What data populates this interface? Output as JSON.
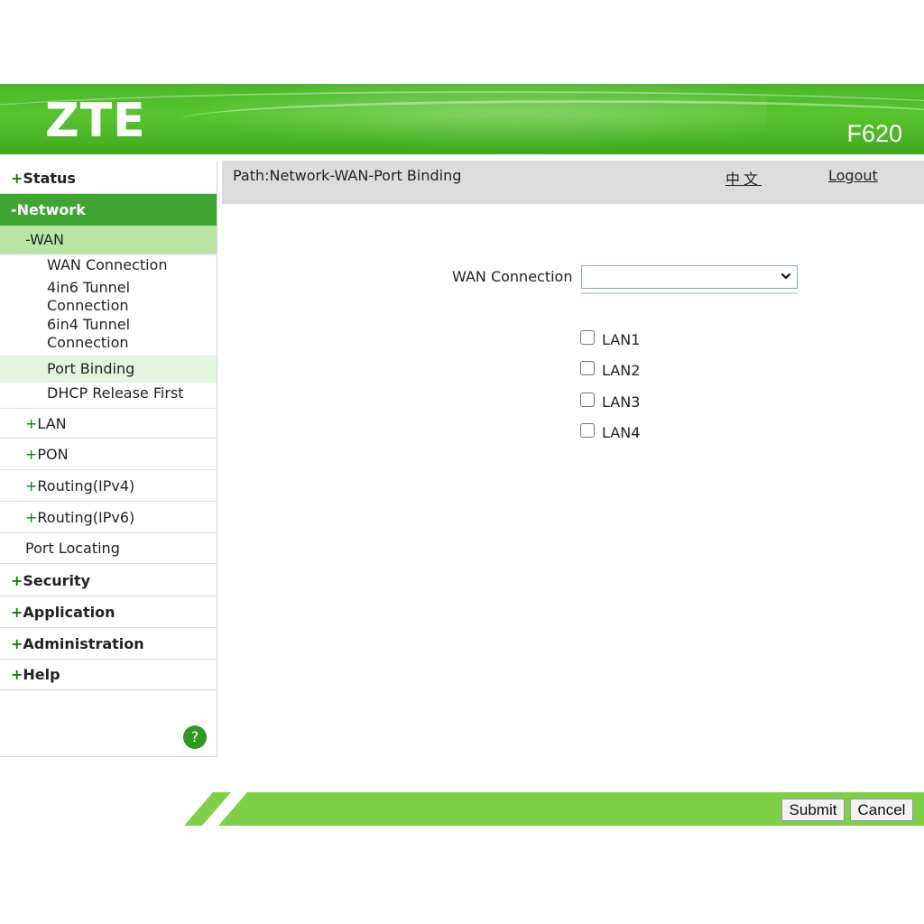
{
  "header": {
    "brand": "ZTE",
    "model": "F620",
    "colors": {
      "primary_green": "#4cb82a",
      "active_green": "#3fa531",
      "footer_green": "#7ed047"
    }
  },
  "sidebar": {
    "status": {
      "prefix": "+",
      "label": "Status"
    },
    "network": {
      "prefix": "-",
      "label": "Network"
    },
    "wan": {
      "prefix": "-",
      "label": "WAN"
    },
    "wan_items": {
      "wan_connection": "WAN Connection",
      "tunnel_4in6_line1": "4in6 Tunnel",
      "tunnel_4in6_line2": "Connection",
      "tunnel_6in4_line1": "6in4 Tunnel",
      "tunnel_6in4_line2": "Connection",
      "port_binding": "Port Binding",
      "dhcp_release_first": "DHCP Release First"
    },
    "lan": {
      "prefix": "+",
      "label": "LAN"
    },
    "pon": {
      "prefix": "+",
      "label": "PON"
    },
    "routing_ipv4": {
      "prefix": "+",
      "label": "Routing(IPv4)"
    },
    "routing_ipv6": {
      "prefix": "+",
      "label": "Routing(IPv6)"
    },
    "port_locating": {
      "label": "Port Locating"
    },
    "security": {
      "prefix": "+",
      "label": "Security"
    },
    "application": {
      "prefix": "+",
      "label": "Application"
    },
    "administration": {
      "prefix": "+",
      "label": "Administration"
    },
    "help": {
      "prefix": "+",
      "label": "Help"
    },
    "help_icon": "?"
  },
  "pathbar": {
    "path": "Path:Network-WAN-Port Binding",
    "language": "中文",
    "logout": "Logout"
  },
  "form": {
    "wan_connection_label": "WAN Connection",
    "wan_connection_value": "",
    "lan_ports": [
      {
        "label": "LAN1",
        "checked": false
      },
      {
        "label": "LAN2",
        "checked": false
      },
      {
        "label": "LAN3",
        "checked": false
      },
      {
        "label": "LAN4",
        "checked": false
      }
    ]
  },
  "footer": {
    "submit": "Submit",
    "cancel": "Cancel"
  }
}
